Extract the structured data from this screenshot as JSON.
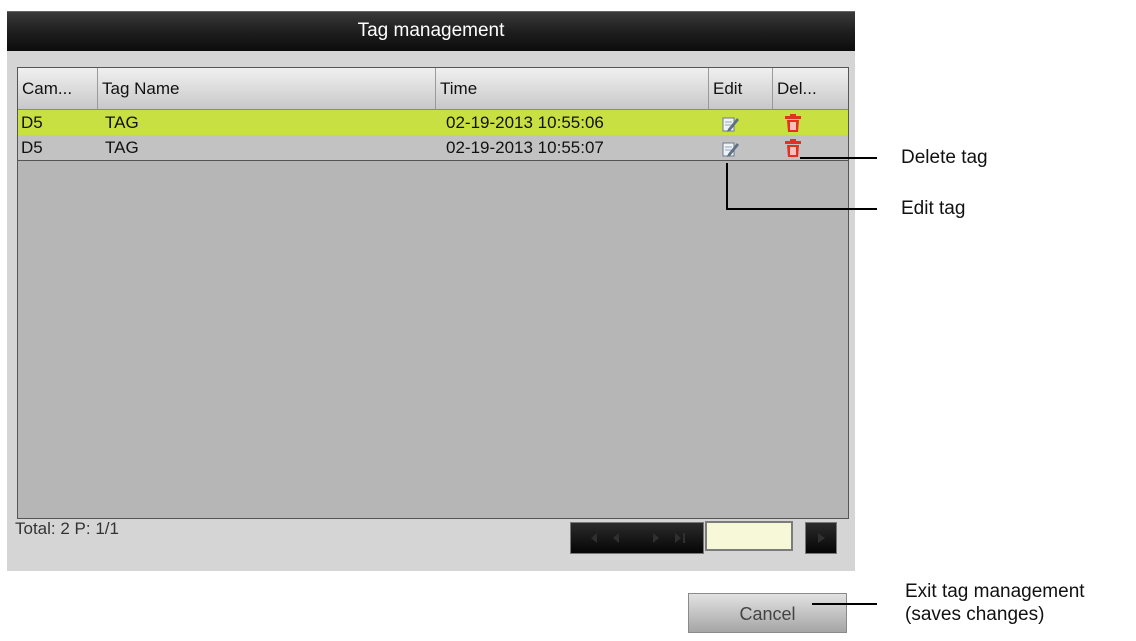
{
  "window": {
    "title": "Tag management"
  },
  "table": {
    "columns": [
      "Cam...",
      "Tag Name",
      "Time",
      "Edit",
      "Del..."
    ],
    "rows": [
      {
        "camera": "D5",
        "tag_name": "TAG",
        "time": "02-19-2013 10:55:06",
        "edit_icon": "edit-icon",
        "delete_icon": "trash-icon",
        "selected": true
      },
      {
        "camera": "D5",
        "tag_name": "TAG",
        "time": "02-19-2013 10:55:07",
        "edit_icon": "edit-icon",
        "delete_icon": "trash-icon",
        "selected": false
      }
    ]
  },
  "footer": {
    "total_label": "Total: 2 P: 1/1",
    "page_input_value": ""
  },
  "buttons": {
    "cancel_label": "Cancel"
  },
  "annotations": {
    "delete_tag": "Delete tag",
    "edit_tag": "Edit tag",
    "exit_line1": "Exit tag management",
    "exit_line2": "(saves changes)"
  },
  "colors": {
    "selected_row": "#c9e043",
    "delete_icon": "#e0321e",
    "title_bar": "#1e1e1e"
  }
}
